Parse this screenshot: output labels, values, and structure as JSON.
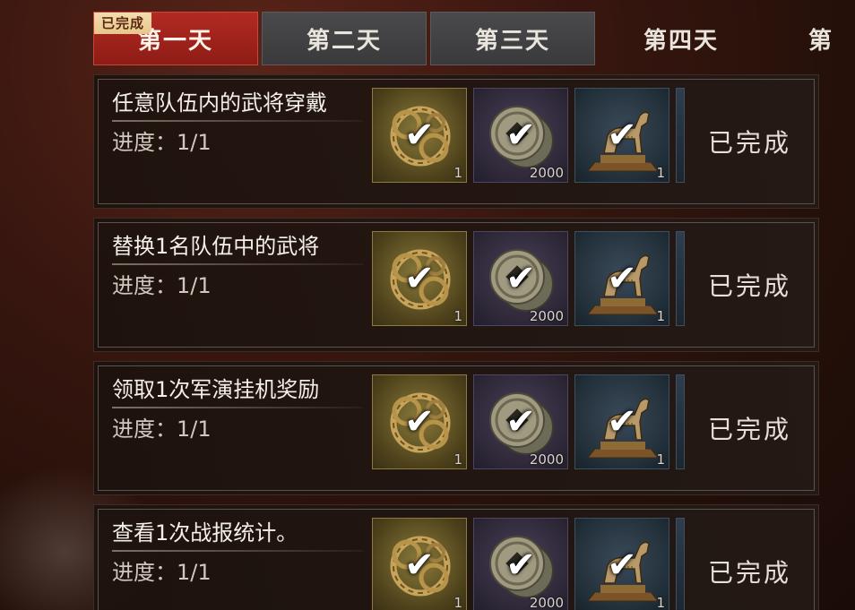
{
  "tabs": [
    {
      "label": "第一天",
      "state": "active",
      "badge": "已完成"
    },
    {
      "label": "第二天",
      "state": "inactive"
    },
    {
      "label": "第三天",
      "state": "inactive"
    },
    {
      "label": "第四天",
      "state": "plain"
    },
    {
      "label": "第",
      "state": "plain"
    }
  ],
  "tasks": [
    {
      "title": "任意队伍内的武将穿戴",
      "progress": "进度：1/1",
      "status": "已完成",
      "rewards": [
        {
          "icon": "dragon-ring-icon",
          "quantity": "1",
          "completed": true
        },
        {
          "icon": "copper-coin-icon",
          "quantity": "2000",
          "completed": true
        },
        {
          "icon": "bronze-horse-icon",
          "quantity": "1",
          "completed": true
        }
      ]
    },
    {
      "title": "替换1名队伍中的武将",
      "progress": "进度：1/1",
      "status": "已完成",
      "rewards": [
        {
          "icon": "dragon-ring-icon",
          "quantity": "1",
          "completed": true
        },
        {
          "icon": "copper-coin-icon",
          "quantity": "2000",
          "completed": true
        },
        {
          "icon": "bronze-horse-icon",
          "quantity": "1",
          "completed": true
        }
      ]
    },
    {
      "title": "领取1次军演挂机奖励",
      "progress": "进度：1/1",
      "status": "已完成",
      "rewards": [
        {
          "icon": "dragon-ring-icon",
          "quantity": "1",
          "completed": true
        },
        {
          "icon": "copper-coin-icon",
          "quantity": "2000",
          "completed": true
        },
        {
          "icon": "bronze-horse-icon",
          "quantity": "1",
          "completed": true
        }
      ]
    },
    {
      "title": "查看1次战报统计。",
      "progress": "进度：1/1",
      "status": "已完成",
      "rewards": [
        {
          "icon": "dragon-ring-icon",
          "quantity": "1",
          "completed": true
        },
        {
          "icon": "copper-coin-icon",
          "quantity": "2000",
          "completed": true
        },
        {
          "icon": "bronze-horse-icon",
          "quantity": "1",
          "completed": true
        }
      ]
    }
  ],
  "check_glyph": "✔",
  "colors": {
    "active_tab": "#a82420",
    "badge": "#f0d29e",
    "gold_frame": "#8d7a3c",
    "purple_frame": "#4e455e",
    "blue_frame": "#3e5060"
  }
}
